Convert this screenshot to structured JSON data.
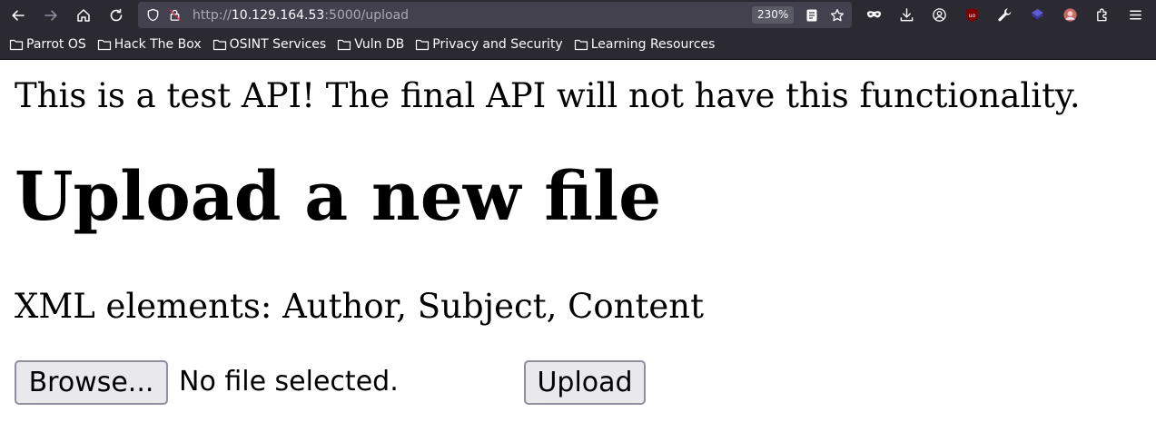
{
  "browser": {
    "url": {
      "scheme": "http://",
      "host": "10.129.164.53",
      "path": ":5000/upload"
    },
    "zoom_level": "230%",
    "nav_icons": [
      "back-icon",
      "forward-icon",
      "home-icon",
      "reload-icon"
    ],
    "extension_icons": [
      "mask-icon",
      "download-icon",
      "account-icon",
      "ublock-icon",
      "wrench-icon",
      "layers-icon",
      "extension-avatar-icon",
      "extensions-icon",
      "menu-icon"
    ],
    "bookmarks": [
      {
        "label": "Parrot OS"
      },
      {
        "label": "Hack The Box"
      },
      {
        "label": "OSINT Services"
      },
      {
        "label": "Vuln DB"
      },
      {
        "label": "Privacy and Security"
      },
      {
        "label": "Learning Resources"
      }
    ]
  },
  "page": {
    "notice": "This is a test API! The final API will not have this functionality.",
    "title": "Upload a new file",
    "xml_elements": "XML elements: Author, Subject, Content",
    "form": {
      "browse_label": "Browse...",
      "file_status": "No file selected.",
      "upload_label": "Upload"
    }
  },
  "colors": {
    "chrome_bg": "#2b2a33",
    "urlbar_bg": "#42414d",
    "button_bg": "#e9e9ed",
    "button_border": "#8f8f9d"
  }
}
